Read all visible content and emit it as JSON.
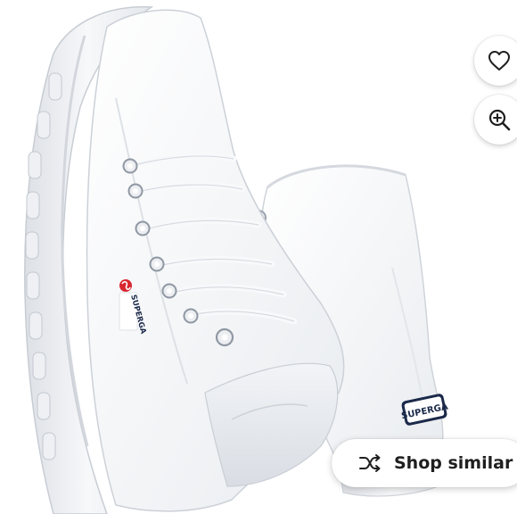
{
  "product": {
    "brand_text_side": "SUPERGA",
    "brand_text_heel": "SUPERGA",
    "image_icon": "white-high-top-sneakers"
  },
  "actions": {
    "favorite_icon": "heart-icon",
    "zoom_icon": "zoom-in-icon",
    "shop_similar": {
      "icon": "shuffle-icon",
      "label": "Shop similar"
    }
  },
  "colors": {
    "background": "#ffffff",
    "button_bg": "#ffffff",
    "icon_color": "#1f1f1f",
    "logo_red": "#d8282f",
    "logo_navy": "#1b2a4a"
  }
}
